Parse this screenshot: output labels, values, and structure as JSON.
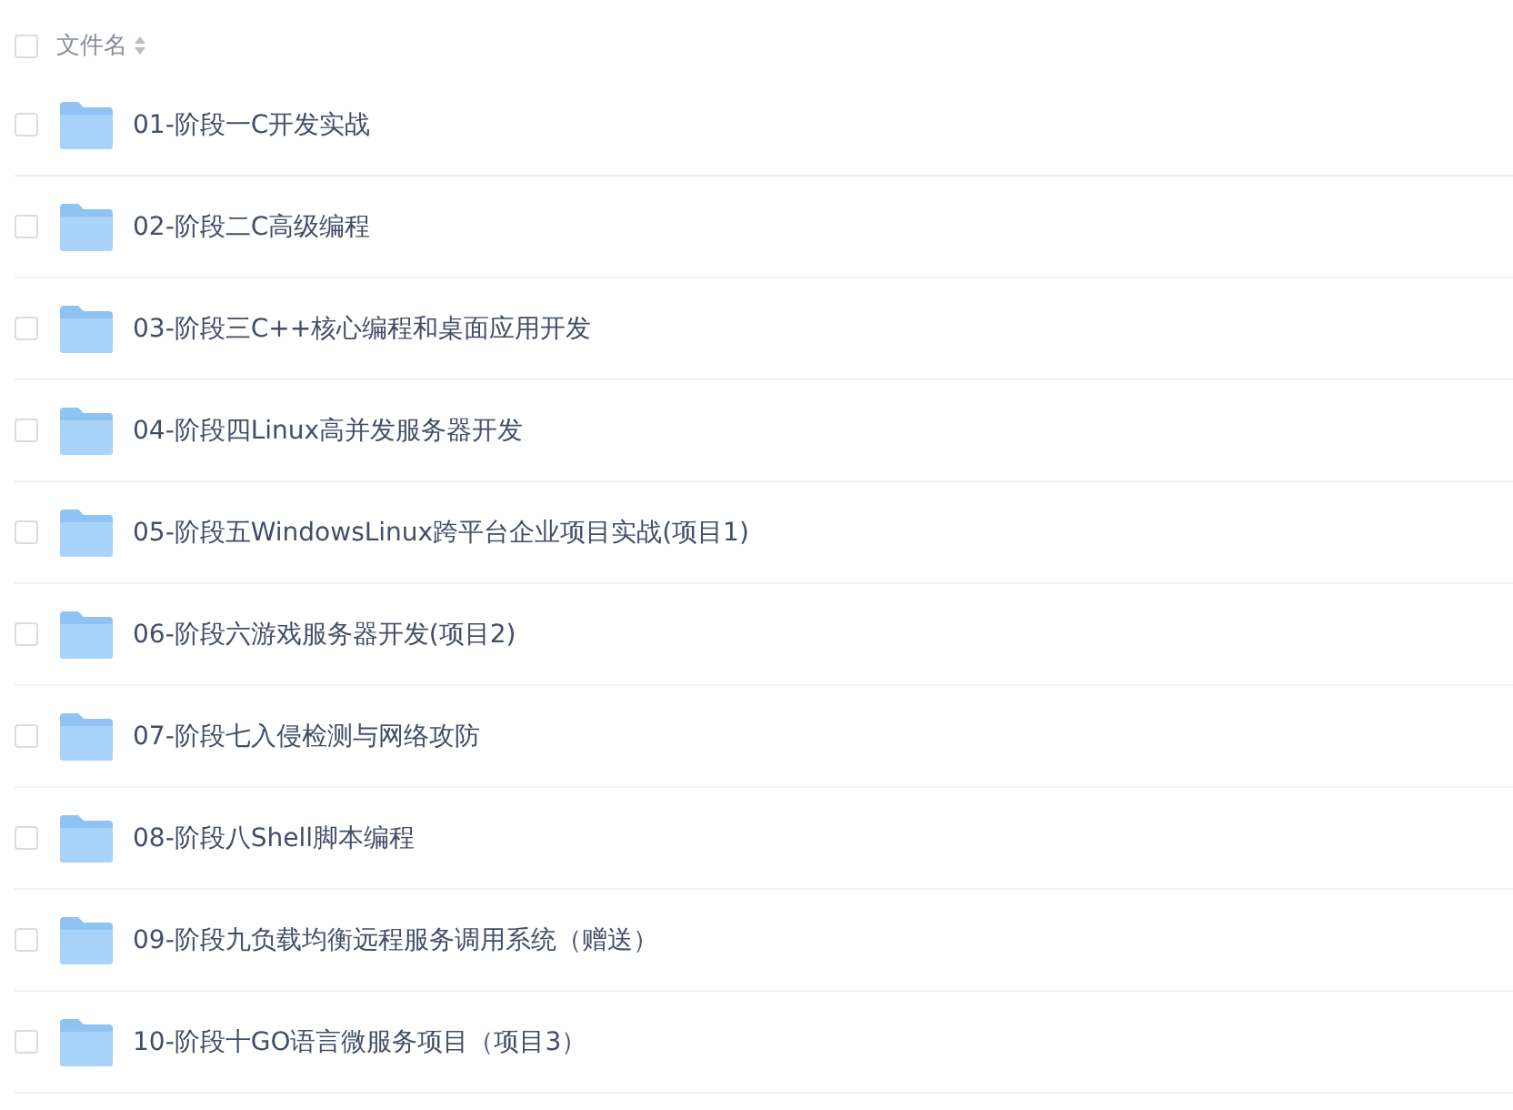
{
  "header": {
    "checked": false,
    "label": "文件名"
  },
  "files": [
    {
      "name": "01-阶段一C开发实战",
      "checked": false
    },
    {
      "name": "02-阶段二C高级编程",
      "checked": false
    },
    {
      "name": "03-阶段三C++核心编程和桌面应用开发",
      "checked": false
    },
    {
      "name": "04-阶段四Linux高并发服务器开发",
      "checked": false
    },
    {
      "name": "05-阶段五WindowsLinux跨平台企业项目实战(项目1)",
      "checked": false
    },
    {
      "name": "06-阶段六游戏服务器开发(项目2)",
      "checked": false
    },
    {
      "name": "07-阶段七入侵检测与网络攻防",
      "checked": false
    },
    {
      "name": "08-阶段八Shell脚本编程",
      "checked": false
    },
    {
      "name": "09-阶段九负载均衡远程服务调用系统（赠送）",
      "checked": false
    },
    {
      "name": "10-阶段十GO语言微服务项目（项目3）",
      "checked": false
    }
  ]
}
